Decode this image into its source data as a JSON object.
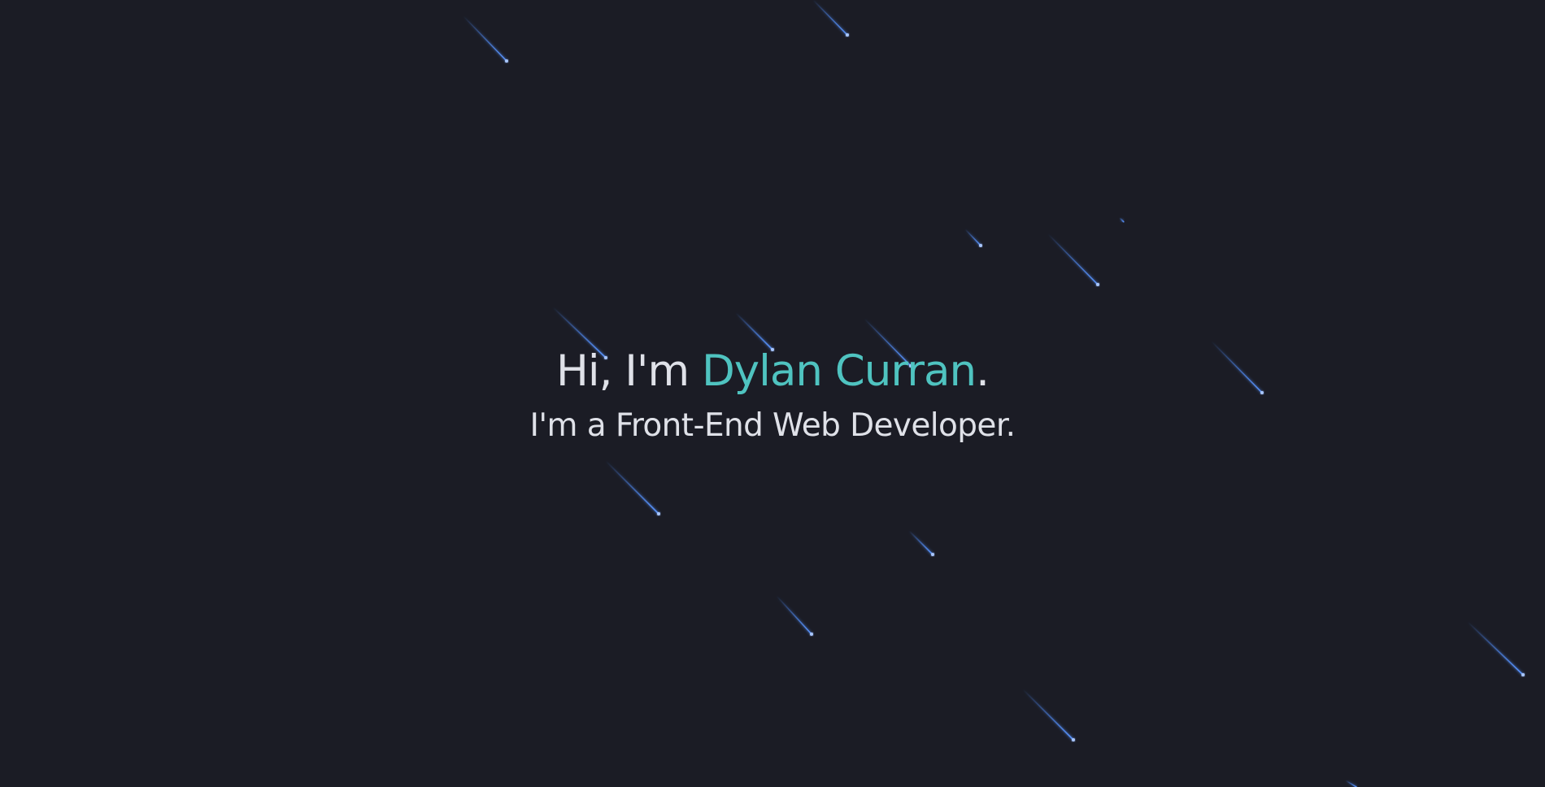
{
  "hero": {
    "greeting": "Hi, I'm ",
    "name": "Dylan Curran",
    "period": ".",
    "subtitle": "I'm a Front-End Web Developer."
  },
  "colors": {
    "background": "#1b1c25",
    "text": "#dfe1e8",
    "accent": "#4fc3c0",
    "star": "#4d8dff"
  }
}
